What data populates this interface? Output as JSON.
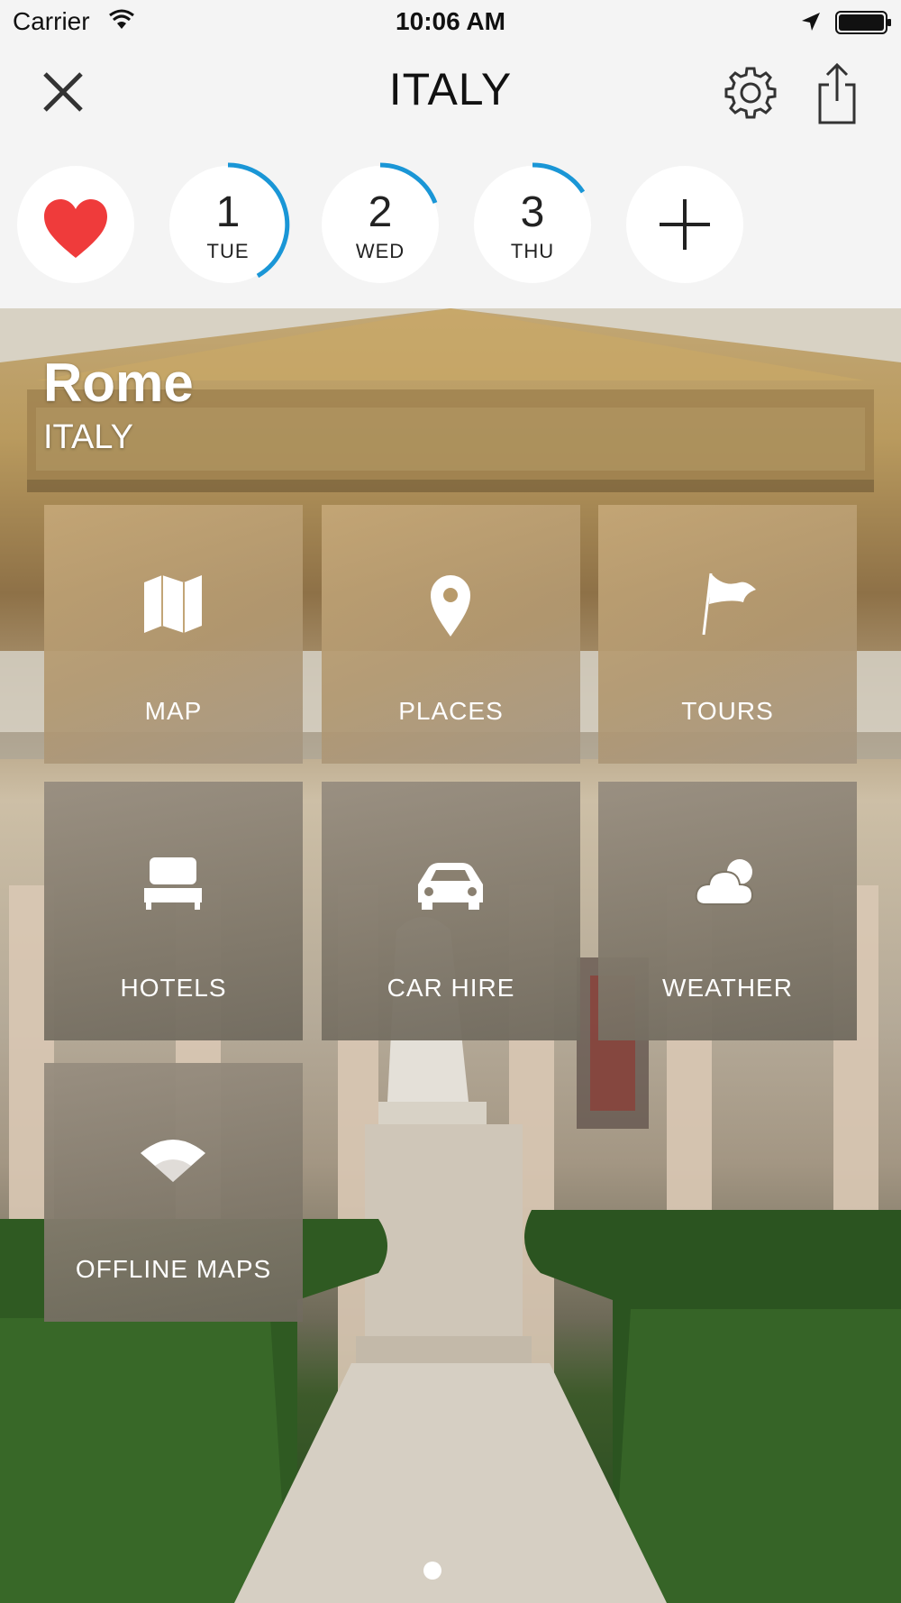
{
  "status_bar": {
    "carrier": "Carrier",
    "time": "10:06 AM"
  },
  "nav": {
    "title": "ITALY",
    "icons": [
      "close-icon",
      "gear-icon",
      "share-icon"
    ]
  },
  "day_selector": {
    "favorites_icon": "heart-icon",
    "favorites_color": "#ef3b3b",
    "days": [
      {
        "number": "1",
        "weekday": "TUE"
      },
      {
        "number": "2",
        "weekday": "WED"
      },
      {
        "number": "3",
        "weekday": "THU"
      }
    ],
    "add_icon": "plus-icon",
    "progress_color": "#1a96d6"
  },
  "destination": {
    "city": "Rome",
    "country": "ITALY"
  },
  "tiles": [
    {
      "label": "MAP",
      "icon": "map-icon"
    },
    {
      "label": "PLACES",
      "icon": "location-pin-icon"
    },
    {
      "label": "TOURS",
      "icon": "flag-icon"
    },
    {
      "label": "HOTELS",
      "icon": "bed-icon"
    },
    {
      "label": "CAR HIRE",
      "icon": "car-icon"
    },
    {
      "label": "WEATHER",
      "icon": "cloud-icon"
    },
    {
      "label": "OFFLINE MAPS",
      "icon": "wifi-icon"
    }
  ]
}
